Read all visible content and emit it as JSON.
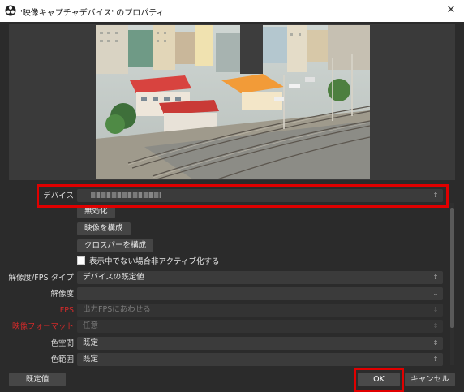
{
  "window": {
    "title": "'映像キャプチャデバイス' のプロパティ",
    "app_icon": "obs-logo-icon",
    "close_glyph": "✕"
  },
  "preview": {
    "content": "camera-preview-image",
    "colors": {
      "highlight": "#e00000"
    }
  },
  "properties": {
    "device": {
      "label": "デバイス",
      "value": ""
    },
    "deactivate_button": "無効化",
    "configure_video_button": "映像を構成",
    "configure_crossbar_button": "クロスバーを構成",
    "deactivate_when_hidden": {
      "label": "表示中でない場合非アクティブ化する",
      "checked": false
    },
    "resolution_fps_type": {
      "label": "解像度/FPS タイプ",
      "value": "デバイスの既定値"
    },
    "resolution": {
      "label": "解像度",
      "value": ""
    },
    "fps": {
      "label": "FPS",
      "value": "出力FPSにあわせる"
    },
    "video_format": {
      "label": "映像フォーマット",
      "value": "任意"
    },
    "color_space": {
      "label": "色空間",
      "value": "既定"
    },
    "color_range": {
      "label": "色範囲",
      "value": "既定"
    }
  },
  "footer": {
    "defaults": "既定値",
    "ok": "OK",
    "cancel": "キャンセル"
  }
}
